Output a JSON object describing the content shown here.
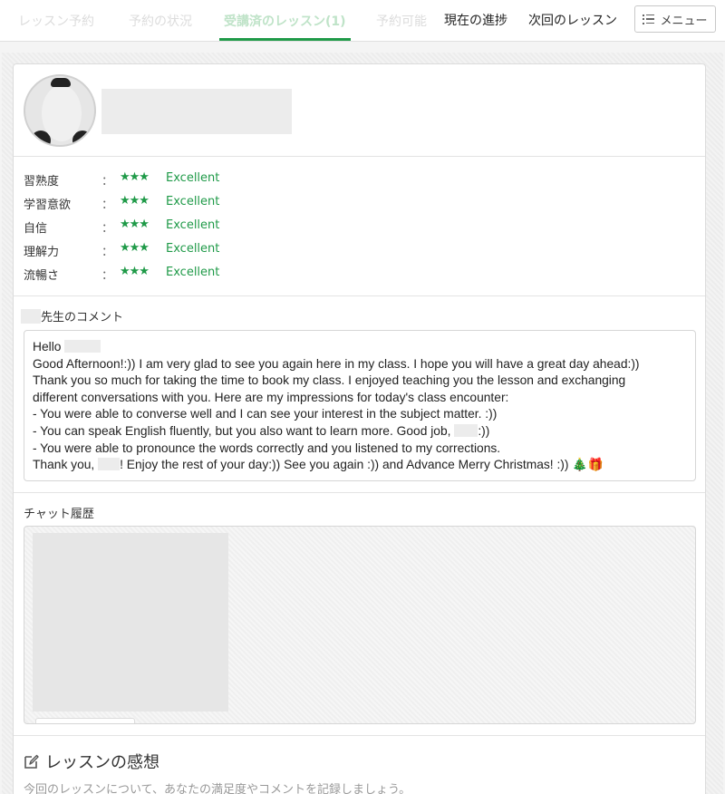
{
  "tabs": [
    {
      "label": "レッスン予約",
      "state": "faded"
    },
    {
      "label": "予約の状況",
      "state": "faded"
    },
    {
      "label": "受講済のレッスン(1)",
      "state": "active"
    },
    {
      "label": "予約可能",
      "state": "faded"
    }
  ],
  "header": {
    "progress_link": "現在の進捗",
    "next_lesson_link": "次回のレッスン",
    "menu_label": "メニュー"
  },
  "ratings": [
    {
      "label": "習熟度",
      "colon": "：",
      "stars": "★★★",
      "score": 3,
      "text": "Excellent"
    },
    {
      "label": "学習意欲",
      "colon": "：",
      "stars": "★★★",
      "score": 3,
      "text": "Excellent"
    },
    {
      "label": "自信",
      "colon": "：",
      "stars": "★★★",
      "score": 3,
      "text": "Excellent"
    },
    {
      "label": "理解力",
      "colon": "：",
      "stars": "★★★",
      "score": 3,
      "text": "Excellent"
    },
    {
      "label": "流暢さ",
      "colon": "：",
      "stars": "★★★",
      "score": 3,
      "text": "Excellent"
    }
  ],
  "comment_section": {
    "label": "先生のコメント",
    "lines": [
      "Hello",
      "Good Afternoon!:)) I am very glad to see you again here in my class. I hope you will have a great day ahead:))",
      "Thank you so much for taking the time to book my class. I enjoyed teaching you the lesson and exchanging",
      "different conversations with you. Here are my impressions for today's class encounter:",
      "- You were able to converse well and I can see your interest in the subject matter. :))",
      "- You can speak English fluently, but you also want to learn more. Good job,",
      ":))",
      "- You were able to pronounce the words correctly and you listened to my corrections.",
      "Thank you,",
      "! Enjoy the rest of your day:)) See you again :)) and Advance Merry Christmas! :)) 🎄🎁"
    ]
  },
  "chat_section": {
    "label": "チャット履歴"
  },
  "impressions": {
    "title": "レッスンの感想",
    "description": "今回のレッスンについて、あなたの満足度やコメントを記録しましょう。"
  },
  "colors": {
    "accent": "#1f9a48",
    "border": "#dcdcdc"
  }
}
